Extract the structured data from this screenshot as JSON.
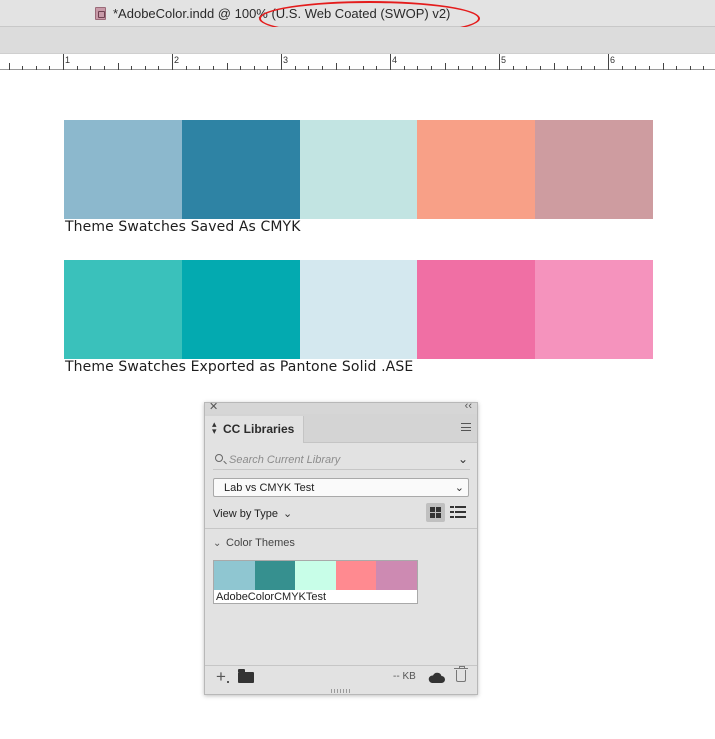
{
  "window": {
    "tab_title": "*AdobeColor.indd @ 100% (U.S. Web Coated (SWOP) v2)"
  },
  "ruler": {
    "labels": [
      "1",
      "2",
      "3",
      "4",
      "5",
      "6"
    ]
  },
  "swatch_rows": [
    {
      "caption": "Theme Swatches Saved As CMYK",
      "colors": [
        "#8cb8cd",
        "#2e83a4",
        "#c2e4e2",
        "#f8a087",
        "#ce9ca0"
      ]
    },
    {
      "caption": "Theme Swatches Exported as Pantone Solid .ASE",
      "colors": [
        "#3ac1bb",
        "#03aab0",
        "#d4e8ef",
        "#f06fa4",
        "#f593bd"
      ]
    }
  ],
  "panel": {
    "tab_label": "CC Libraries",
    "search_placeholder": "Search Current Library",
    "library_select": "Lab vs CMYK Test",
    "view_by": "View by Type",
    "section_label": "Color Themes",
    "theme": {
      "name": "AdobeColorCMYKTest",
      "colors": [
        "#8fc6d1",
        "#36908f",
        "#c8fee8",
        "#ff8a90",
        "#cd8ab2"
      ]
    },
    "storage": "-- KB"
  },
  "icons": {
    "doc": "indesign-doc-icon",
    "close": "close-icon",
    "collapse": "collapse-icon",
    "menu": "panel-menu-icon",
    "search": "search-icon",
    "chevron": "chevron-down-icon",
    "grid": "grid-view-icon",
    "list": "list-view-icon",
    "add": "plus-icon",
    "folder": "folder-icon",
    "cloud": "cloud-icon",
    "trash": "trash-icon"
  }
}
